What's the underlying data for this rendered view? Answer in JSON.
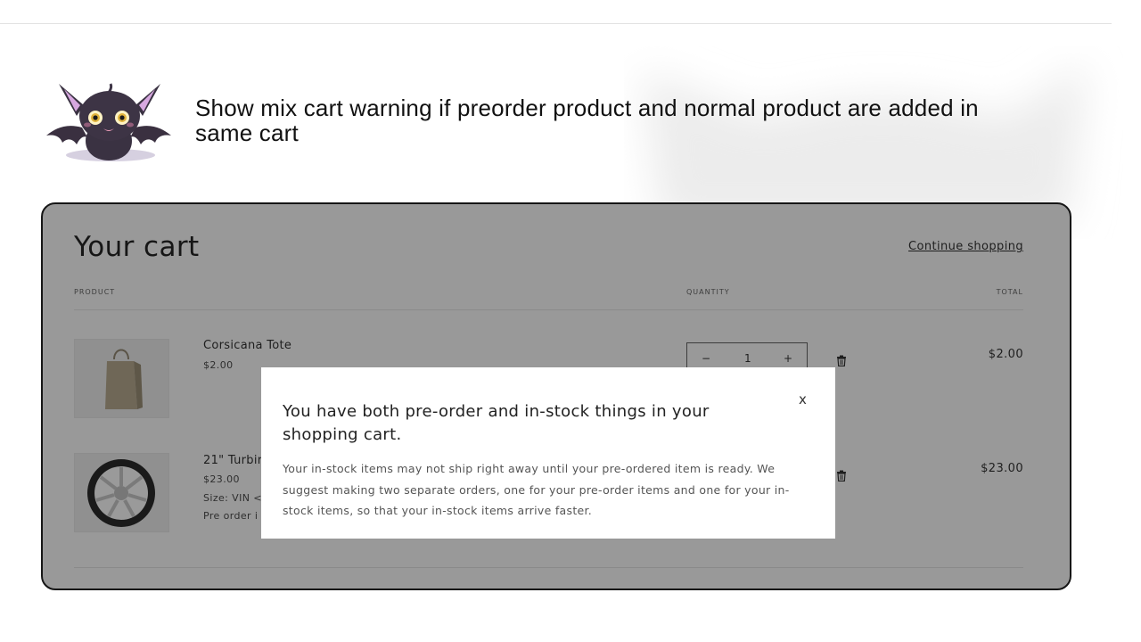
{
  "headline": "Show mix cart warning if preorder product and normal product are added in same cart",
  "cart": {
    "title": "Your cart",
    "continue_label": "Continue shopping",
    "columns": {
      "product": "PRODUCT",
      "quantity": "QUANTITY",
      "total": "TOTAL"
    },
    "items": [
      {
        "name": "Corsicana Tote",
        "price": "$2.00",
        "quantity": "1",
        "decrement": "−",
        "increment": "+",
        "total": "$2.00"
      },
      {
        "name": "21\" Turbir",
        "price": "$23.00",
        "option": "Size: VIN <",
        "note": "Pre order i",
        "total": "$23.00"
      }
    ]
  },
  "modal": {
    "title": "You have both pre-order and in-stock things in your shopping cart.",
    "close": "x",
    "body": "Your in-stock items may not ship right away until your pre-ordered item is ready. We suggest making two separate orders, one for your pre-order items and one for your in-stock items, so that your in-stock items arrive faster."
  }
}
